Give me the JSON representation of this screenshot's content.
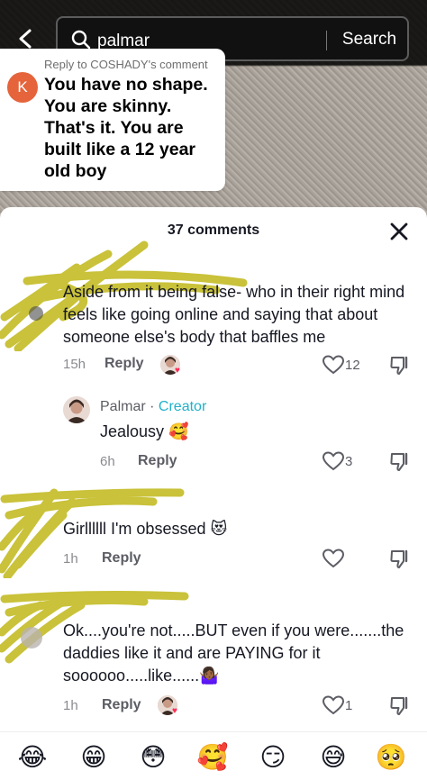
{
  "search": {
    "query": "palmar",
    "button_label": "Search"
  },
  "reply_bubble": {
    "avatar_letter": "K",
    "header": "Reply to COSHADY's comment",
    "body": "You have no shape. You are skinny. That's it. You are built like a 12 year old boy"
  },
  "sheet": {
    "title": "37 comments"
  },
  "comments": [
    {
      "text": "Aside from it being false- who in their right mind feels like going online and saying that about someone else's body that baffles me",
      "time": "15h",
      "reply_label": "Reply",
      "likes": "12"
    },
    {
      "username": "Palmar",
      "separator": "·",
      "badge": "Creator",
      "text": "Jealousy 🥰",
      "time": "6h",
      "reply_label": "Reply",
      "likes": "3"
    },
    {
      "text": "Girllllll I'm obsessed 😻",
      "time": "1h",
      "reply_label": "Reply"
    },
    {
      "text": "Ok....you're not.....BUT even if you were.......the daddies like it and are PAYING for it soooooo.....like......🤷🏾‍♀️",
      "time": "1h",
      "reply_label": "Reply",
      "likes": "1"
    }
  ],
  "emoji_bar": [
    "😂",
    "😁",
    "😳",
    "🥰",
    "😏",
    "😅",
    "🥺"
  ],
  "colors": {
    "accent_creator": "#20b2c8",
    "heart": "#fe2c55",
    "scribble": "#c9c23a",
    "reply_avatar": "#e5643b"
  },
  "icons": [
    "back-chevron",
    "search",
    "close",
    "heart-outline",
    "thumbs-down-outline"
  ]
}
